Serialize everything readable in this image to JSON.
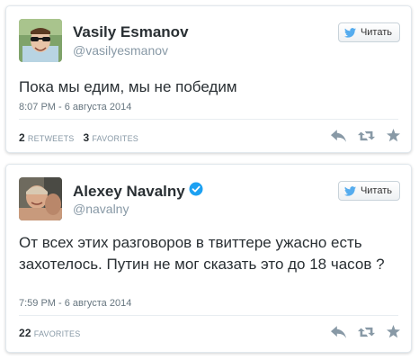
{
  "tweets": [
    {
      "name": "Vasily Esmanov",
      "handle": "@vasilyesmanov",
      "verified": false,
      "follow_label": "Читать",
      "text": "Пока мы едим, мы не победим",
      "timestamp": "8:07 PM - 6 августа 2014",
      "retweets_count": "2",
      "retweets_label": "RETWEETS",
      "favorites_count": "3",
      "favorites_label": "FAVORITES"
    },
    {
      "name": "Alexey Navalny",
      "handle": "@navalny",
      "verified": true,
      "follow_label": "Читать",
      "text": "От всех этих разговоров в твиттере ужасно есть захотелось. Путин не мог сказать это до 18 часов ?",
      "timestamp": "7:59 PM - 6 августа 2014",
      "favorites_count": "22",
      "favorites_label": "FAVORITES"
    }
  ],
  "colors": {
    "twitter_blue": "#55acee",
    "verified_blue": "#1da1f2",
    "text": "#292f33",
    "muted": "#8899a6",
    "icon_gray": "#8899a6"
  },
  "icons": [
    "twitter-bird-icon",
    "reply-icon",
    "retweet-icon",
    "favorite-star-icon",
    "verified-badge-icon"
  ]
}
